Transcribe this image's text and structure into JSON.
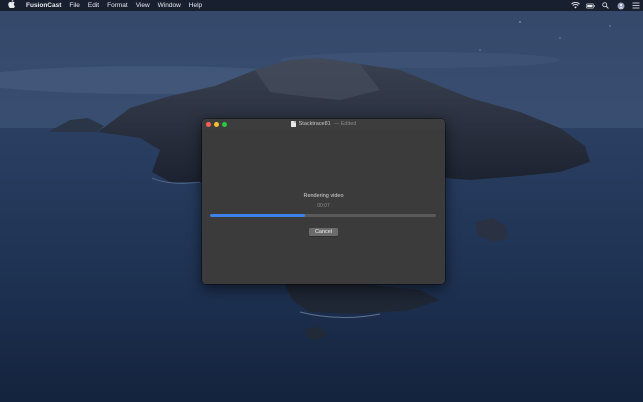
{
  "menubar": {
    "app_name": "FusionCast",
    "menus": [
      "File",
      "Edit",
      "Format",
      "View",
      "Window",
      "Help"
    ],
    "status_icons": [
      "wifi-icon",
      "battery-icon",
      "search-icon",
      "siri-icon",
      "control-center-icon"
    ]
  },
  "window": {
    "title": "Stacktrace81",
    "title_suffix": "— Edited",
    "status_text": "Rendering video",
    "elapsed_time": "00:07",
    "progress_fraction": 0.42,
    "cancel_label": "Cancel"
  },
  "colors": {
    "accent": "#3d82e8",
    "close": "#fe5f57",
    "minimize": "#febc2e",
    "maximize": "#28c840"
  }
}
